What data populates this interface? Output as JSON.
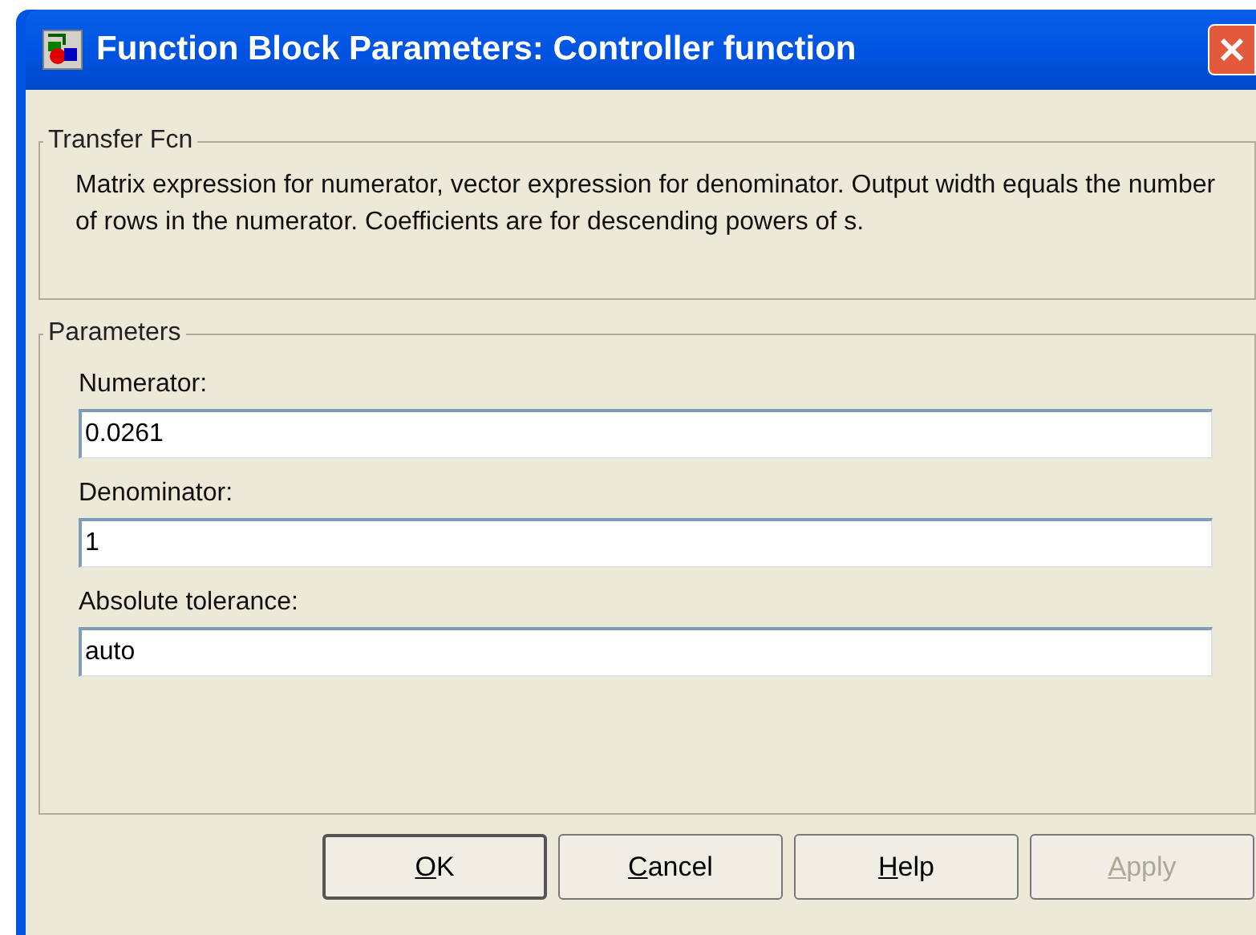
{
  "window": {
    "title": "Function Block Parameters: Controller function"
  },
  "description_group": {
    "title": "Transfer Fcn",
    "text": "Matrix expression for numerator, vector expression for denominator.  Output width equals the number of rows in the numerator.  Coefficients are for descending powers of s."
  },
  "parameters_group": {
    "title": "Parameters",
    "fields": [
      {
        "label": "Numerator:",
        "value": "0.0261"
      },
      {
        "label": "Denominator:",
        "value": "1"
      },
      {
        "label": "Absolute tolerance:",
        "value": "auto"
      }
    ]
  },
  "buttons": [
    {
      "label": "OK",
      "default": true,
      "disabled": false
    },
    {
      "label": "Cancel",
      "default": false,
      "disabled": false
    },
    {
      "label": "Help",
      "default": false,
      "disabled": false
    },
    {
      "label": "Apply",
      "default": false,
      "disabled": true
    }
  ]
}
